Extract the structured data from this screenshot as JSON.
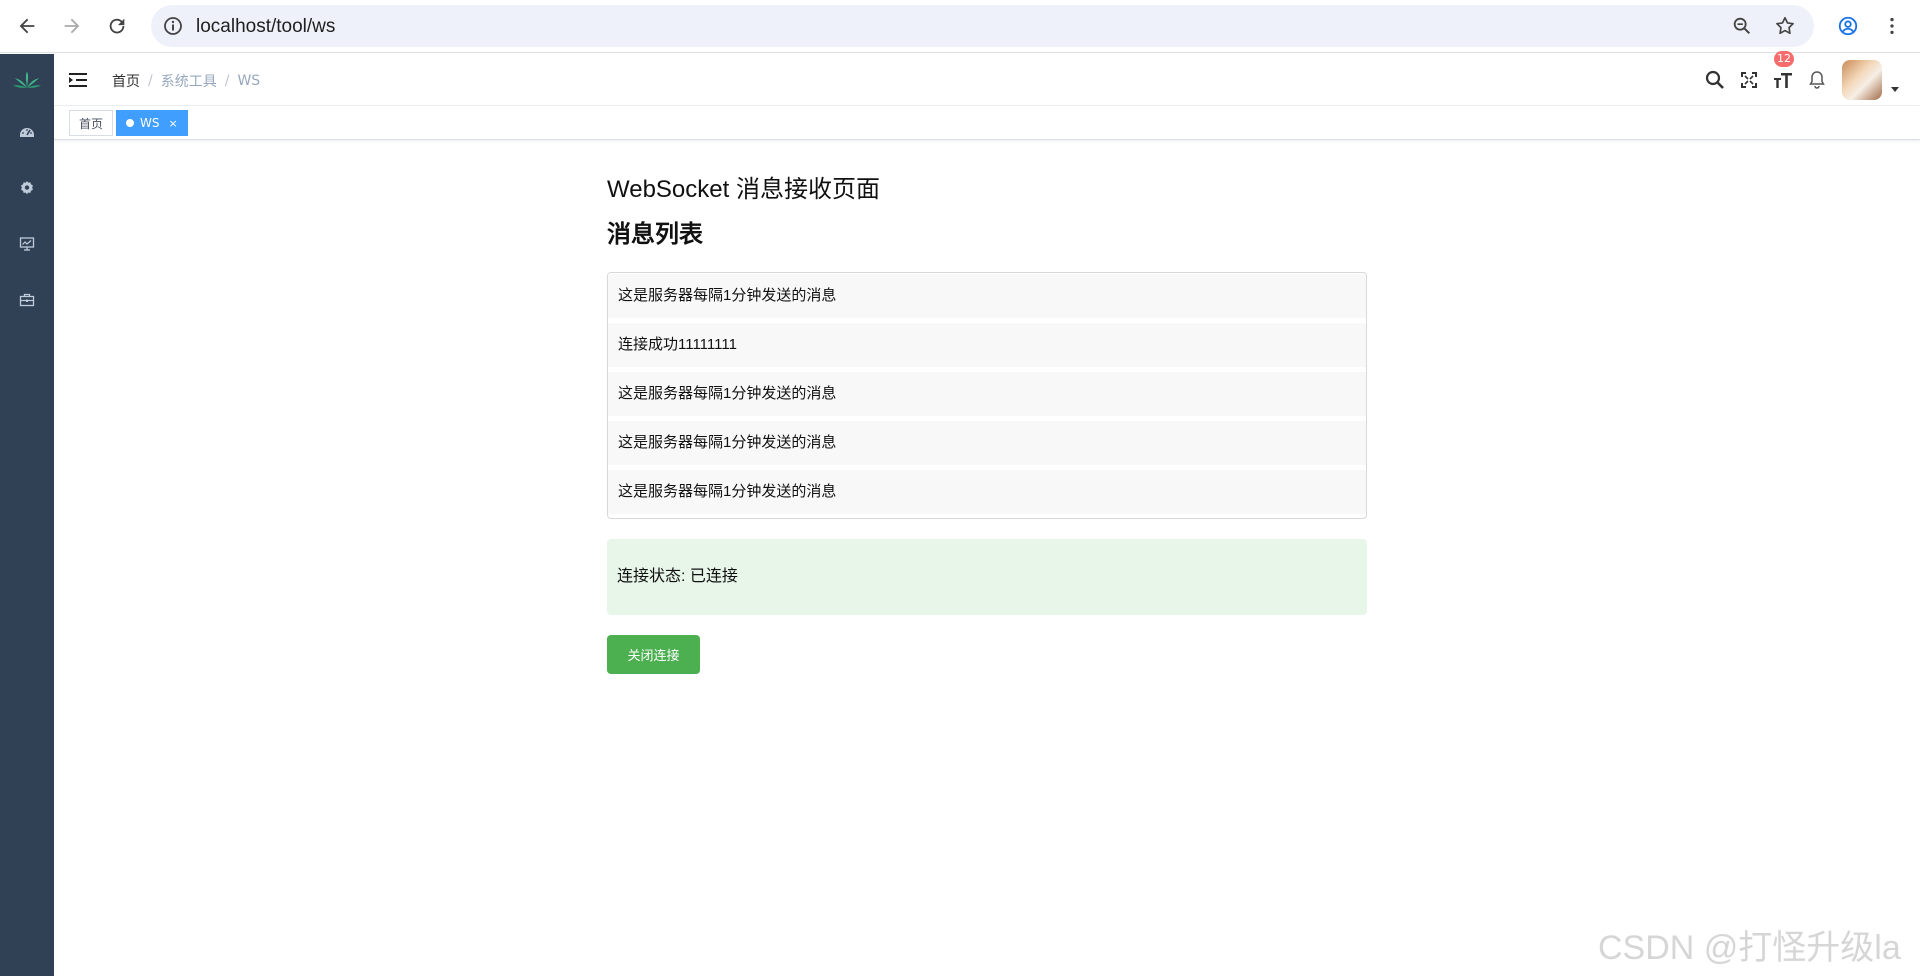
{
  "browser": {
    "url": "localhost/tool/ws"
  },
  "sidebar": {
    "items": [
      {
        "icon": "logo-icon"
      },
      {
        "icon": "dashboard-icon"
      },
      {
        "icon": "gear-icon"
      },
      {
        "icon": "monitor-icon"
      },
      {
        "icon": "toolbox-icon"
      }
    ],
    "bg_color": "#304156"
  },
  "navbar": {
    "breadcrumb": [
      "首页",
      "系统工具",
      "WS"
    ],
    "separator": "/",
    "notification_count": "12"
  },
  "tags": [
    {
      "label": "首页",
      "active": false
    },
    {
      "label": "WS",
      "active": true,
      "close": "×"
    }
  ],
  "main": {
    "title": "WebSocket 消息接收页面",
    "list_title": "消息列表",
    "messages": [
      "这是服务器每隔1分钟发送的消息",
      "连接成功11111111",
      "这是服务器每隔1分钟发送的消息",
      "这是服务器每隔1分钟发送的消息",
      "这是服务器每隔1分钟发送的消息"
    ],
    "status_text": "连接状态: 已连接",
    "close_button": "关闭连接",
    "status_bg": "#e8f5e9",
    "button_color": "#4caf50"
  },
  "watermark": "CSDN @打怪升级la"
}
